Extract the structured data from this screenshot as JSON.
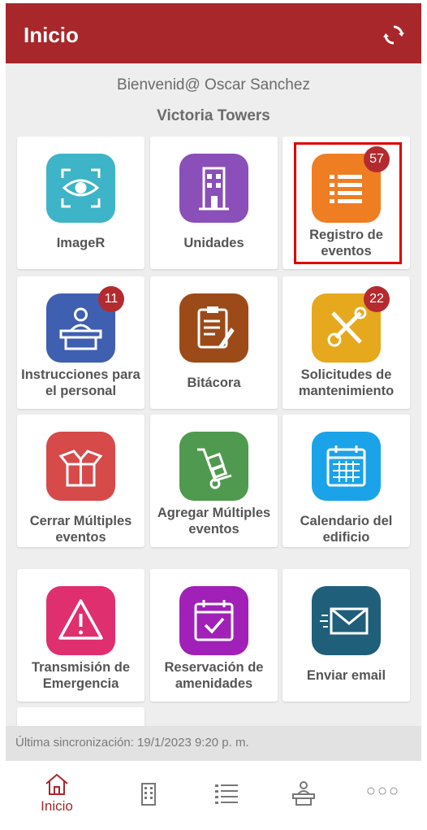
{
  "header": {
    "title": "Inicio",
    "sync_icon": "refresh-icon"
  },
  "welcome": "Bienvenid@ Oscar Sanchez",
  "building": "Victoria Towers",
  "tiles": [
    {
      "label": "ImageR",
      "icon": "eye-scan-icon",
      "color": "#3db4c7"
    },
    {
      "label": "Unidades",
      "icon": "building-icon",
      "color": "#8a4fb8"
    },
    {
      "label": "Registro de eventos",
      "icon": "list-icon",
      "color": "#ef7d22",
      "badge": "57",
      "highlighted": true
    },
    {
      "label": "Instrucciones para el personal",
      "icon": "receptionist-icon",
      "color": "#3f5fb0",
      "badge": "11"
    },
    {
      "label": "Bitácora",
      "icon": "clipboard-icon",
      "color": "#9c4a18"
    },
    {
      "label": "Solicitudes de mantenimiento",
      "icon": "tools-icon",
      "color": "#e6a81c",
      "badge": "22"
    },
    {
      "label": "Cerrar Múltiples eventos",
      "icon": "open-box-icon",
      "color": "#d64a4a"
    },
    {
      "label": "Agregar Múltiples eventos",
      "icon": "hand-truck-icon",
      "color": "#4f9a4f"
    },
    {
      "label": "Calendario del edificio",
      "icon": "calendar-icon",
      "color": "#1aa3e8"
    },
    {
      "label": "Transmisión de Emergencia",
      "icon": "warning-icon",
      "color": "#df2f6e"
    },
    {
      "label": "Reservación de amenidades",
      "icon": "calendar-check-icon",
      "color": "#a020b8"
    },
    {
      "label": "Enviar email",
      "icon": "envelope-icon",
      "color": "#1f5f7a"
    }
  ],
  "sync_status": "Última sincronización: 19/1/2023 9:20 p. m.",
  "nav": [
    {
      "label": "Inicio",
      "icon": "home-icon",
      "active": true
    },
    {
      "label": "",
      "icon": "building-icon"
    },
    {
      "label": "",
      "icon": "list-icon"
    },
    {
      "label": "",
      "icon": "receptionist-icon"
    },
    {
      "label": "",
      "icon": "more-icon"
    }
  ],
  "colors": {
    "brand": "#a8272b",
    "badge": "#b42b2f",
    "highlight": "#e00000"
  }
}
